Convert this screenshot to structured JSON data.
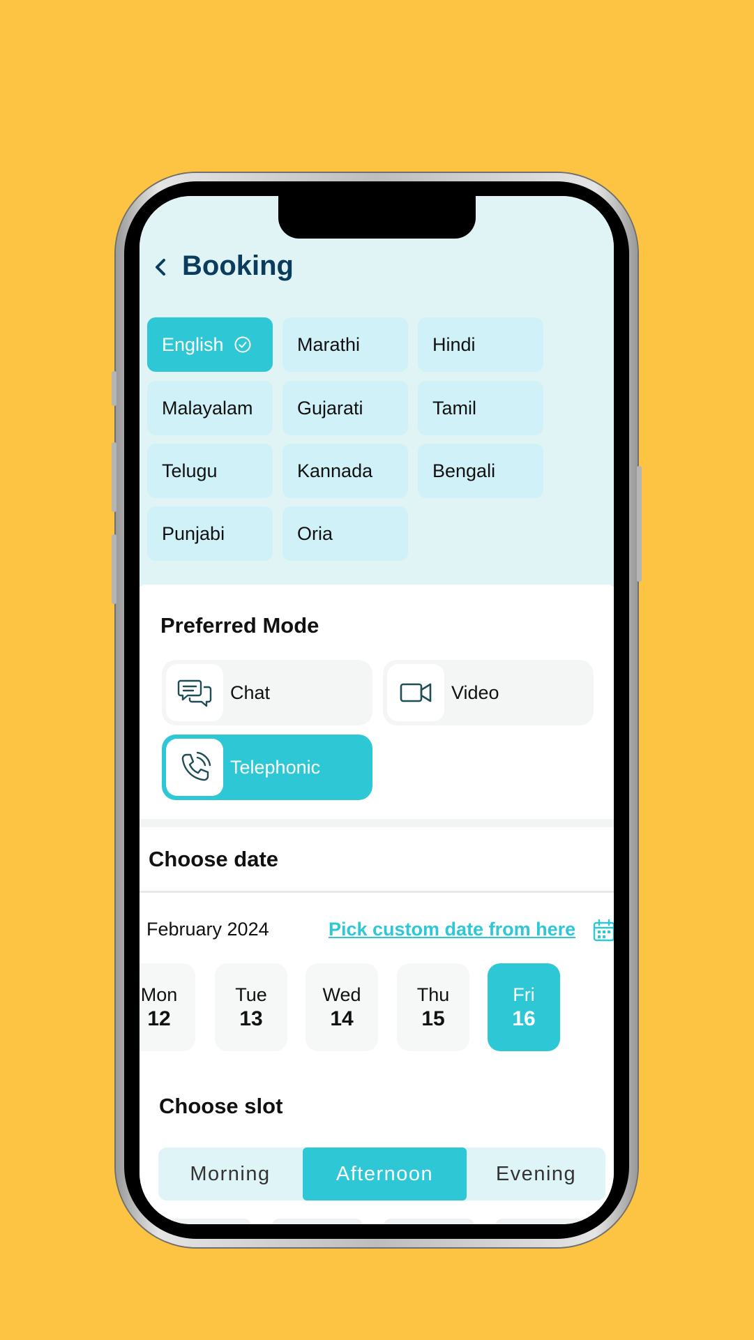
{
  "header": {
    "title": "Booking"
  },
  "languages": [
    {
      "label": "English",
      "selected": true
    },
    {
      "label": "Marathi",
      "selected": false
    },
    {
      "label": "Hindi",
      "selected": false
    },
    {
      "label": "Malayalam",
      "selected": false
    },
    {
      "label": "Gujarati",
      "selected": false
    },
    {
      "label": "Tamil",
      "selected": false
    },
    {
      "label": "Telugu",
      "selected": false
    },
    {
      "label": "Kannada",
      "selected": false
    },
    {
      "label": "Bengali",
      "selected": false
    },
    {
      "label": "Punjabi",
      "selected": false
    },
    {
      "label": "Oria",
      "selected": false
    }
  ],
  "preferred_mode": {
    "title": "Preferred Mode",
    "options": [
      {
        "label": "Chat",
        "icon": "chat-icon",
        "selected": false
      },
      {
        "label": "Video",
        "icon": "video-icon",
        "selected": false
      },
      {
        "label": "Telephonic",
        "icon": "phone-icon",
        "selected": true
      }
    ]
  },
  "date": {
    "title": "Choose date",
    "month": "February 2024",
    "custom_link": "Pick custom date from here",
    "days": [
      {
        "name": "Mon",
        "num": "12",
        "selected": false
      },
      {
        "name": "Tue",
        "num": "13",
        "selected": false
      },
      {
        "name": "Wed",
        "num": "14",
        "selected": false
      },
      {
        "name": "Thu",
        "num": "15",
        "selected": false
      },
      {
        "name": "Fri",
        "num": "16",
        "selected": true
      }
    ]
  },
  "slot": {
    "title": "Choose slot",
    "tabs": [
      {
        "label": "Morning",
        "selected": false
      },
      {
        "label": "Afternoon",
        "selected": true
      },
      {
        "label": "Evening",
        "selected": false
      }
    ]
  },
  "colors": {
    "background": "#FDC444",
    "accent": "#2EC7D6",
    "title": "#0A3C5E",
    "chip": "#CFF1F7"
  }
}
